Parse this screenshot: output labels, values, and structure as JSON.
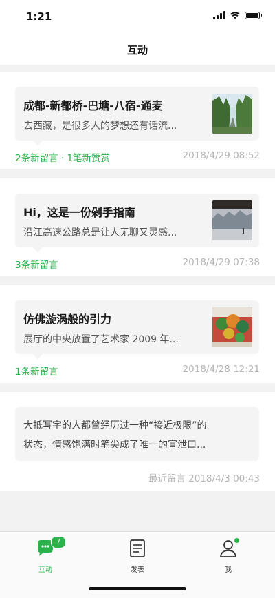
{
  "status_bar": {
    "time": "1:21"
  },
  "header": {
    "title": "互动"
  },
  "messages": [
    {
      "title": "成都-新都桥-巴塘-八宿-通麦",
      "excerpt": "去西藏，是很多人的梦想还有话流...",
      "activity": "2条新留言 · 1笔新赞赏",
      "date": "2018/4/29  08:52",
      "thumb_icon": "forest-road-photo"
    },
    {
      "title": "Hi，这是一份剁手指南",
      "excerpt": "沿江高速公路总是让人无聊又灵感...",
      "activity": "3条新留言",
      "date": "2018/4/29  07:38",
      "thumb_icon": "gallery-room-photo"
    },
    {
      "title": "仿佛漩涡般的引力",
      "excerpt": "展厅的中央放置了艺术家 2009 年...",
      "activity": "1条新留言",
      "date": "2018/4/28  12:21",
      "thumb_icon": "art-sculpture-photo"
    },
    {
      "excerpt_line1": "大抵写字的人都曾经历过一种“接近极限”的",
      "excerpt_line2": "状态，情感饱满时笔尖成了唯一的宣泄口...",
      "date": "最近留言 2018/4/3  00:43"
    }
  ],
  "tabbar": {
    "tabs": [
      {
        "label": "互动",
        "icon": "chat-bubble-icon",
        "badge": "7",
        "active": true
      },
      {
        "label": "发表",
        "icon": "document-icon",
        "active": false
      },
      {
        "label": "我",
        "icon": "person-icon",
        "dot": true,
        "active": false
      }
    ]
  },
  "colors": {
    "accent": "#2bb24c",
    "muted_text": "#b5b5b5",
    "badge": "#2bb24c"
  }
}
